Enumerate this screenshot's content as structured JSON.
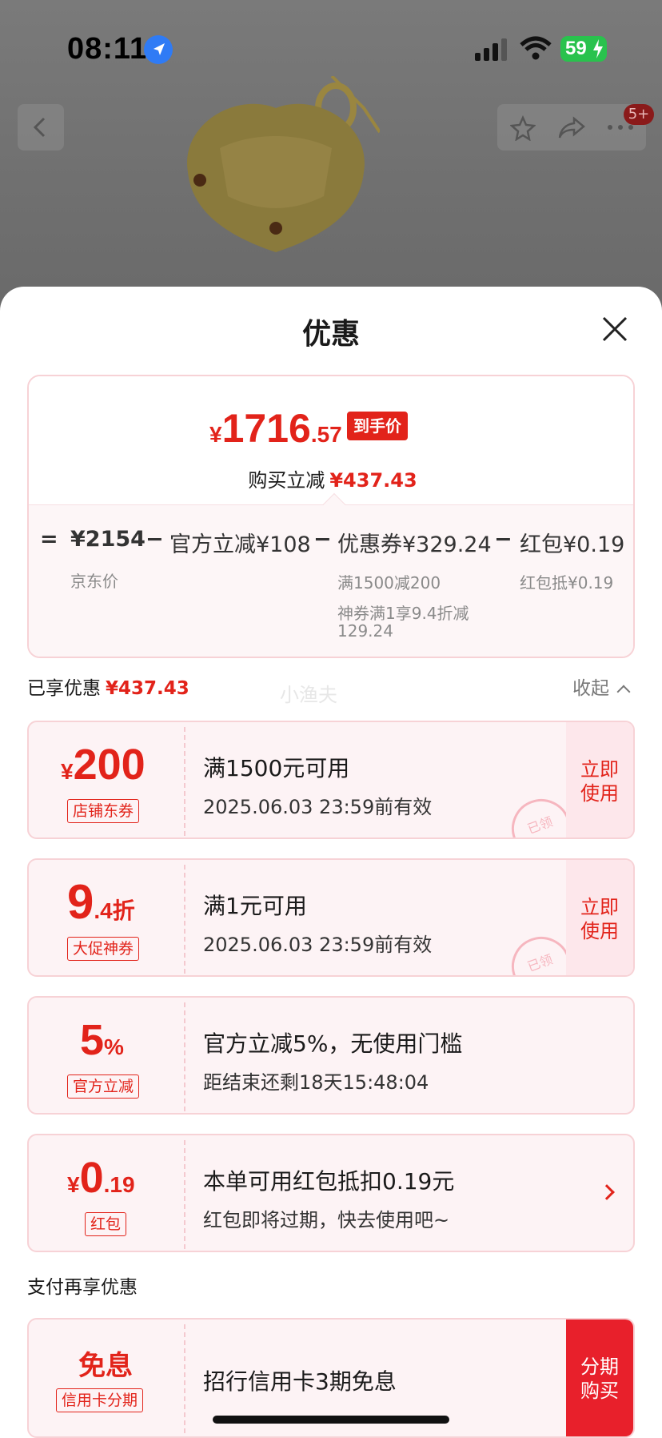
{
  "status_bar": {
    "time": "08:11",
    "battery": "59"
  },
  "product_header": {
    "badge": "5+"
  },
  "sheet": {
    "title": "优惠",
    "summary": {
      "yen": "¥",
      "price_int": "1716",
      "price_dec": ".57",
      "price_tag": "到手价",
      "reduce_label": "购买立减",
      "reduce_amount": "¥437.43",
      "eq": "=",
      "minus": "−",
      "jd_price": "¥2154",
      "jd_price_label": "京东价",
      "official": "官方立减¥108",
      "coupon": "优惠券¥329.24",
      "coupon_sub1": "满1500减200",
      "coupon_sub2a": "神券满1享9.4折减",
      "coupon_sub2b": "129.24",
      "redpacket": "红包¥0.19",
      "redpacket_sub": "红包抵¥0.19"
    },
    "enjoyed": {
      "label": "已享优惠",
      "amount": "¥437.43",
      "collapse": "收起",
      "watermark": "小渔夫"
    },
    "coupons": [
      {
        "main_prefix": "¥",
        "main": "200",
        "main_suffix": "",
        "badge": "店铺东券",
        "title": "满1500元可用",
        "sub": "2025.06.03 23:59前有效",
        "action1": "立即",
        "action2": "使用",
        "stamp": "已领"
      },
      {
        "main_prefix": "",
        "main": "9",
        "main_suffix": ".4折",
        "badge": "大促神券",
        "title": "满1元可用",
        "sub": "2025.06.03 23:59前有效",
        "action1": "立即",
        "action2": "使用",
        "stamp": "已领"
      },
      {
        "main_prefix": "",
        "main": "5",
        "main_suffix": "%",
        "badge": "官方立减",
        "title": "官方立减5%，无使用门槛",
        "sub": "距结束还剩18天15:48:04"
      },
      {
        "main_prefix": "¥",
        "main": "0",
        "main_suffix": ".19",
        "badge": "红包",
        "title": "本单可用红包抵扣0.19元",
        "sub": "红包即将过期，快去使用吧~"
      }
    ],
    "pay": {
      "heading": "支付再享优惠",
      "main": "免息",
      "badge": "信用卡分期",
      "title": "招行信用卡3期免息",
      "action1": "分期",
      "action2": "购买"
    }
  },
  "colors": {
    "accent": "#e2231a",
    "card_bg": "#fdf3f5",
    "card_border": "#f7d2d6"
  }
}
